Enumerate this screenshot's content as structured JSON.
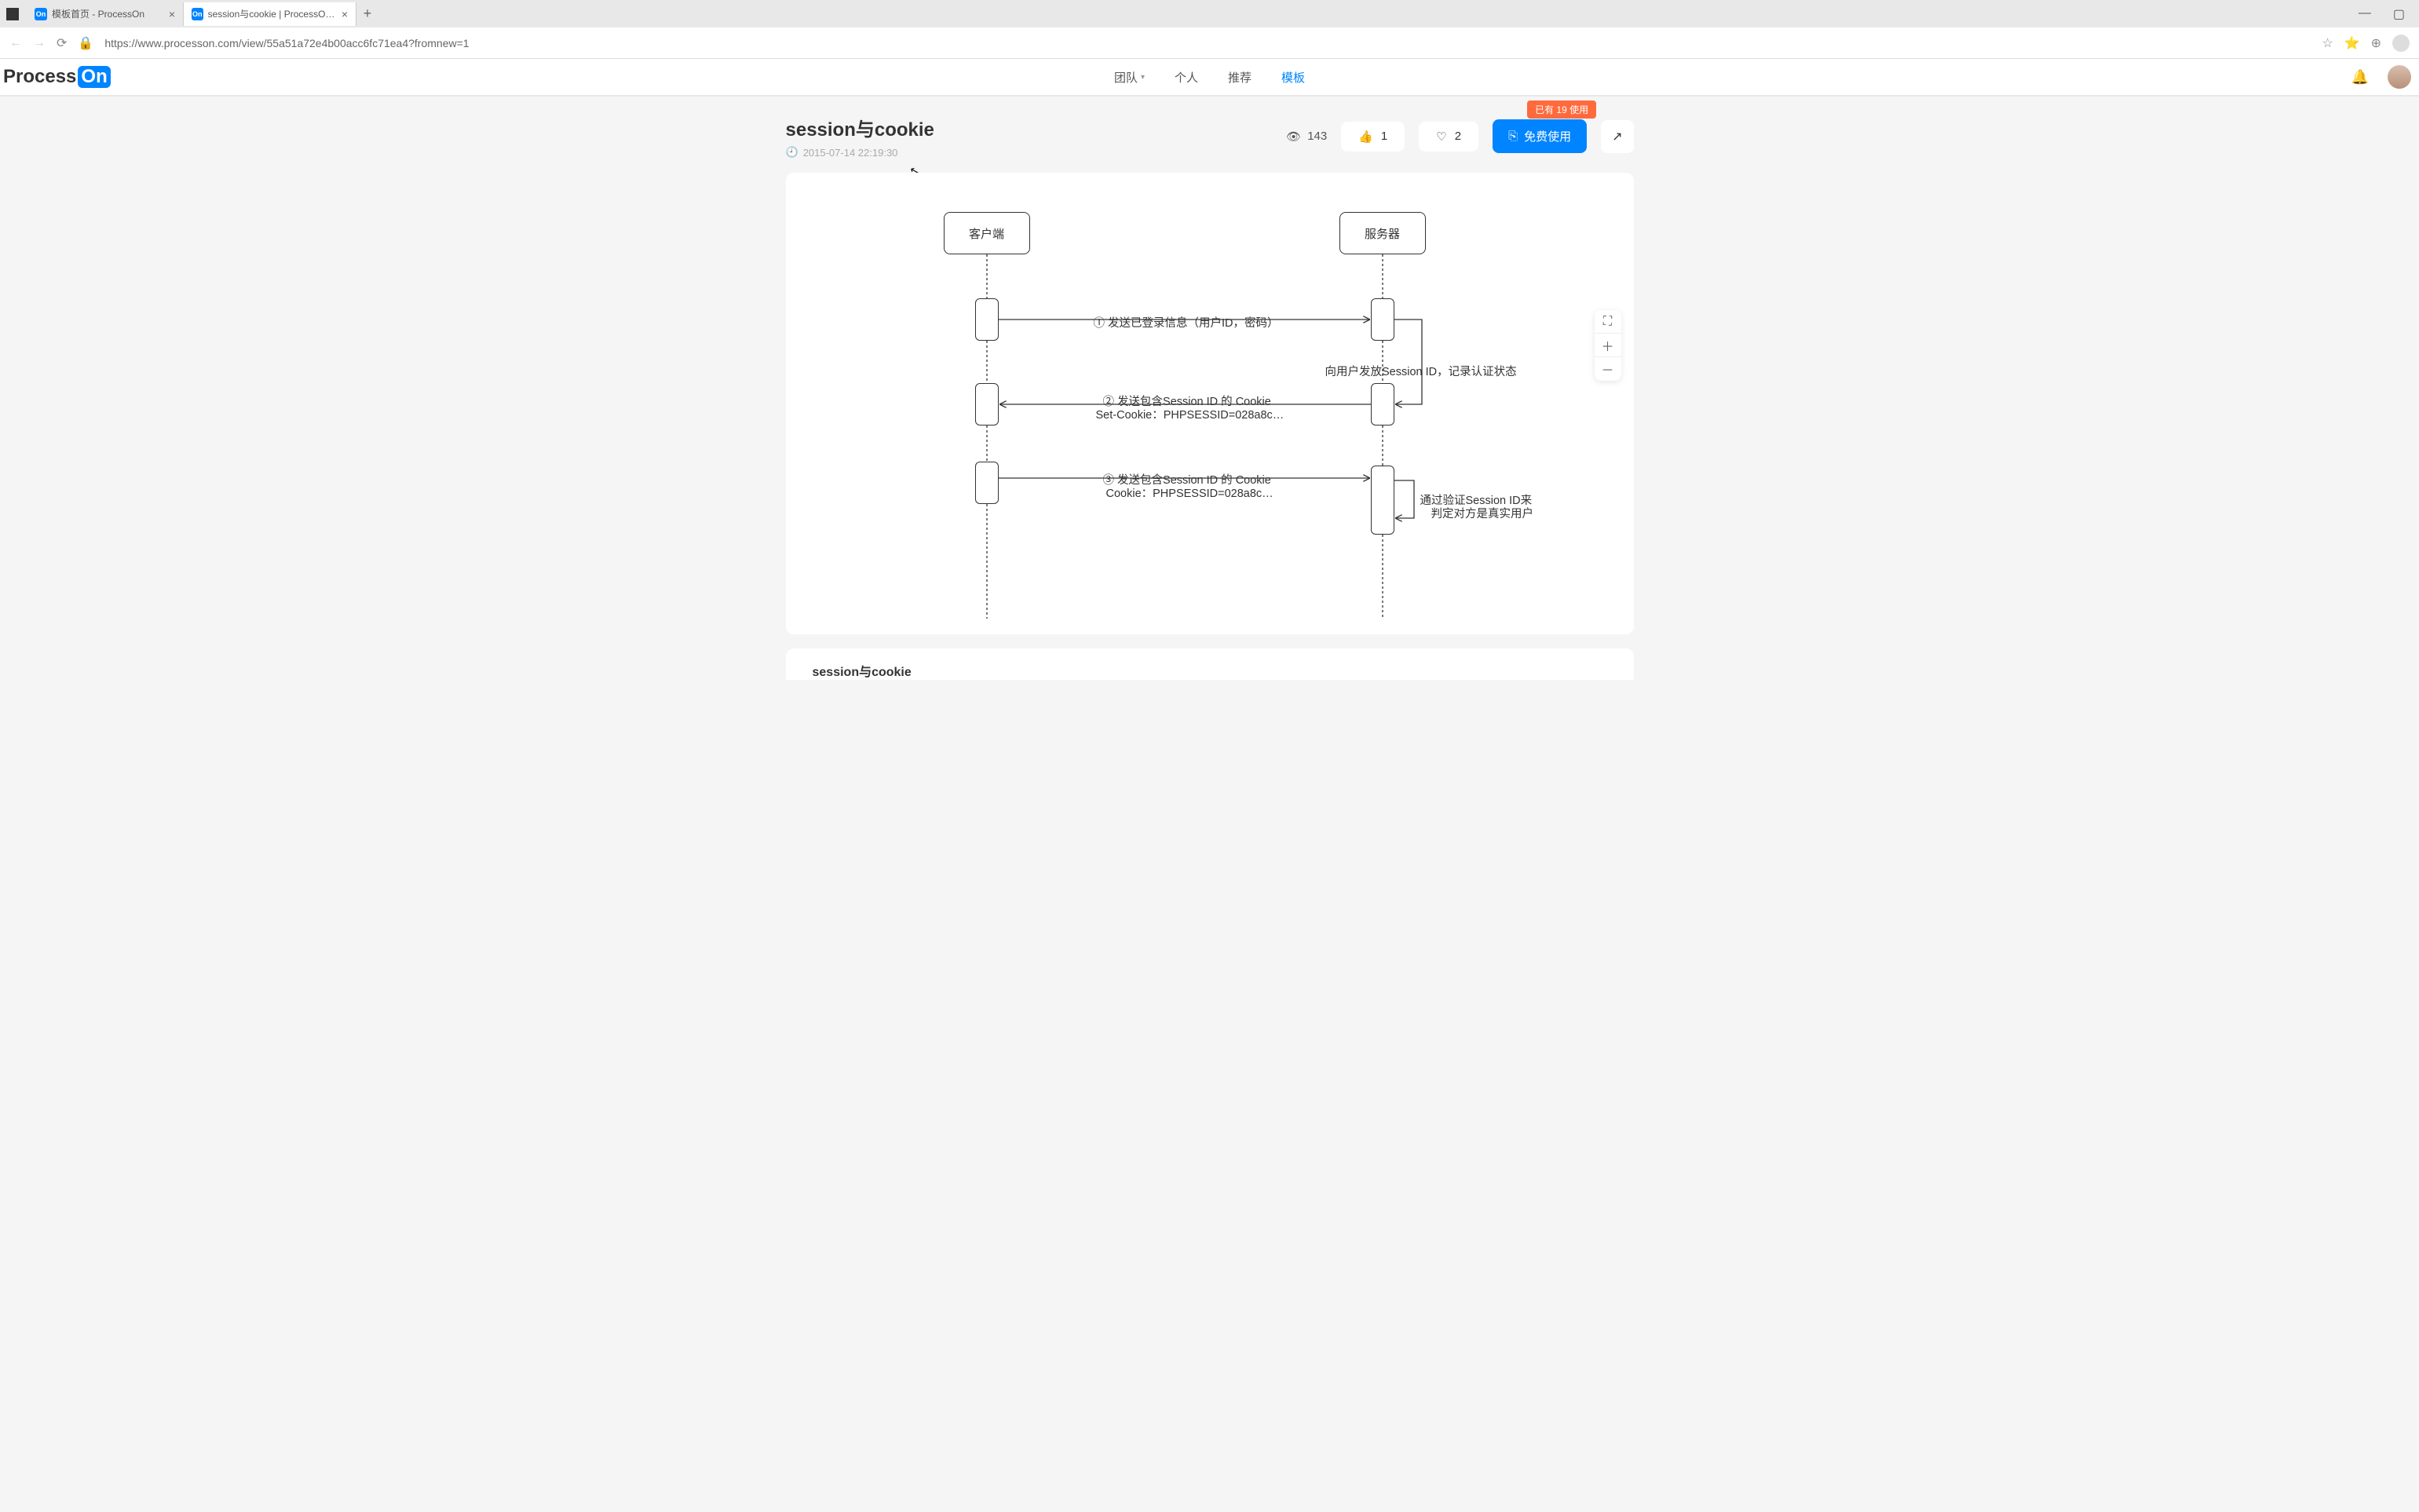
{
  "browser": {
    "tabs": [
      {
        "title": "模板首页 - ProcessOn",
        "active": false
      },
      {
        "title": "session与cookie | ProcessOn免费",
        "active": true
      }
    ],
    "url_display": "https://www.processon.com/view/55a51a72e4b00acc6fc71ea4?fromnew=1"
  },
  "header": {
    "logo_text": "Process",
    "logo_badge": "On",
    "nav": {
      "team": "团队",
      "personal": "个人",
      "recommend": "推荐",
      "template": "模板"
    }
  },
  "content": {
    "title": "session与cookie",
    "timestamp": "2015-07-14 22:19:30",
    "views": "143",
    "likes": "1",
    "favs": "2",
    "use_badge": "已有 19 使用",
    "use_btn": "免费使用"
  },
  "diagram": {
    "client": "客户端",
    "server": "服务器",
    "step1": "① 发送已登录信息（用户ID，密码）",
    "note1": "向用户发放Session ID，记录认证状态",
    "step2a": "② 发送包含Session ID 的 Cookie",
    "step2b": "Set-Cookie：PHPSESSID=028a8c…",
    "step3a": "③ 发送包含Session ID 的 Cookie",
    "step3b": "Cookie：PHPSESSID=028a8c…",
    "note2a": "通过验证Session ID来",
    "note2b": "判定对方是真实用户"
  },
  "footer": {
    "title": "session与cookie"
  }
}
